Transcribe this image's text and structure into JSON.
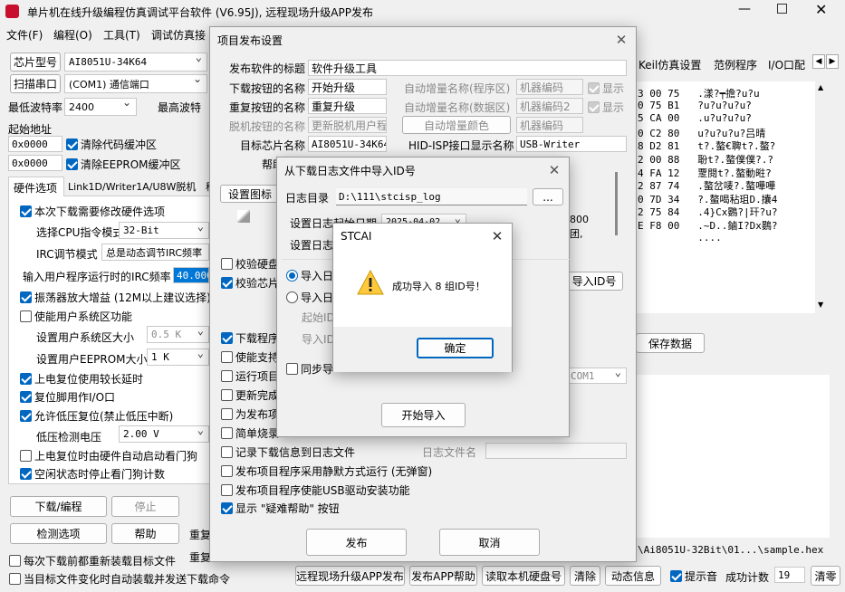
{
  "window": {
    "title": "单片机在线升级编程仿真调试平台软件 (V6.95J), 远程现场升级APP发布"
  },
  "menu": [
    "文件(F)",
    "编程(O)",
    "工具(T)",
    "调试仿真接"
  ],
  "left": {
    "chip_label": "芯片型号",
    "chip_value": "AI8051U-34K64",
    "scan_button": "扫描串口",
    "port_value": "(COM1) 通信端口",
    "min_baud_label": "最低波特率",
    "min_baud_value": "2400",
    "max_baud_label": "最高波特",
    "start_addr_label": "起始地址",
    "addr1": "0x0000",
    "clear_code": "清除代码缓冲区",
    "addr2": "0x0000",
    "clear_eeprom": "清除EEPROM缓冲区",
    "tabs": [
      "硬件选项",
      "Link1D/Writer1A/U8W脱机",
      "程"
    ],
    "opt_modify": "本次下载需要修改硬件选项",
    "cpu_mode_label": "选择CPU指令模式",
    "cpu_mode_value": "32-Bit",
    "irc_label": "IRC调节模式",
    "irc_value": "总是动态调节IRC频率",
    "irc_freq_label": "输入用户程序运行时的IRC频率",
    "irc_freq_value": "40.000",
    "opt_osc": "振荡器放大增益 (12M以上建议选择)",
    "opt_sysarea": "使能用户系统区功能",
    "sysarea_size_label": "设置用户系统区大小",
    "sysarea_size_value": "0.5 K",
    "eeprom_size_label": "设置用户EEPROM大小",
    "eeprom_size_value": "1   K",
    "opt_poweron": "上电复位使用较长延时",
    "opt_reset_io": "复位脚用作I/O口",
    "opt_lvr": "允许低压复位(禁止低压中断)",
    "lv_label": "低压检测电压",
    "lv_value": "2.00 V",
    "opt_wdt": "上电复位时由硬件自动启动看门狗",
    "opt_idle_wdt": "空闲状态时停止看门狗计数",
    "btn_download": "下载/编程",
    "btn_stop": "停止",
    "btn_detect": "检测选项",
    "btn_help": "帮助",
    "redo1": "重复",
    "redo2": "重复",
    "foot1": "每次下载前都重新装载目标文件",
    "foot2": "当目标文件变化时自动装载并发送下载命令"
  },
  "right": {
    "tabs": [
      "Keil仿真设置",
      "范例程序",
      "I/O口配"
    ],
    "hex_lines": [
      "3 00 75   .漾?┯擔?u?u",
      "0 75 B1   ?u?u?u?u?",
      "5 CA 00   .u?u?u?u?",
      "0 C2 80   u?u?u?u?吕晴",
      "8 D2 81   t?.螯€聛t?.螯?",
      "2 00 88   聁t?.螯僕僕?.?",
      "4 FA 12   覂閱t?.螯動暀?",
      "2 87 74   .螯岔唛?.螯嘩嘩",
      "0 7D 34   ?.螯喝秥珇D.攮4",
      "2 75 84   .4}Cx鷃?|玕?u?",
      "E F8 00   .~D..鏀I?Dx鷃?",
      "          ...."
    ],
    "save_button": "保存数据",
    "path_text": "\\Ai8051U-32Bit\\01...\\sample.hex"
  },
  "bottom_bar": {
    "buttons": [
      "远程现场升级APP发布",
      "发布APP帮助",
      "读取本机硬盘号",
      "清除",
      "动态信息"
    ],
    "beep_label": "提示音",
    "count_label": "成功计数",
    "count_value": "19",
    "clear_button": "清零"
  },
  "publish_dialog": {
    "title": "项目发布设置",
    "title_label": "发布软件的标题",
    "title_value": "软件升级工具",
    "dl_btn_label": "下载按钮的名称",
    "dl_btn_value": "开始升级",
    "redo_btn_label": "重复按钮的名称",
    "redo_btn_value": "重复升级",
    "offline_label": "脱机按钮的名称",
    "offline_value": "更新脱机用户程",
    "auto_prog_label": "自动增量名称(程序区)",
    "auto_prog_value": "机器编码",
    "auto_data_label": "自动增量名称(数据区)",
    "auto_data_value": "机器编码2",
    "show1": "显示",
    "show2": "显示",
    "auto_color_button": "自动增量颜色",
    "auto_color_value": "机器编码",
    "target_label": "目标芯片名称",
    "target_value": "AI8051U-34K64",
    "hid_label": "HID-ISP接口显示名称",
    "hid_value": "USB-Writer",
    "help_label": "帮助",
    "set_icon_button": "设置图标",
    "opt_verify_disk": "校验硬盘",
    "opt_verify_chip": "校验芯片",
    "opt_download_prog": "下载程序",
    "opt_enable": "使能支持",
    "opt_run": "运行项目",
    "opt_update": "更新完成",
    "opt_for_publish": "为发布项",
    "opt_simple": "简单烧录",
    "opt_record_log": "记录下载信息到日志文件",
    "log_file_label": "日志文件名",
    "opt_silent": "发布项目程序采用静默方式运行 (无弹窗)",
    "opt_usb_driver": "发布项目程序使能USB驱动安装功能",
    "opt_help_button": "显示 \"疑难帮助\" 按钮",
    "import_id_button": "导入ID号",
    "port_value": "COM1",
    "frag1": "800",
    "frag2": "团,",
    "publish_button": "发布",
    "cancel_button": "取消"
  },
  "import_dialog": {
    "title": "从下载日志文件中导入ID号",
    "log_dir_label": "日志目录",
    "log_dir_value": "D:\\111\\stcisp_log",
    "browse_button": "...",
    "start_date_label": "设置日志起始日期",
    "start_date_value": "2025-04-02",
    "end_label": "设置日志",
    "radio1": "导入日",
    "radio2": "导入日",
    "start_id_label": "起始ID",
    "import_id_label": "导入ID",
    "sync_label": "同步导",
    "start_import_button": "开始导入"
  },
  "message_box": {
    "title": "STCAI",
    "message": "成功导入 8 组ID号！",
    "ok_button": "确定"
  }
}
